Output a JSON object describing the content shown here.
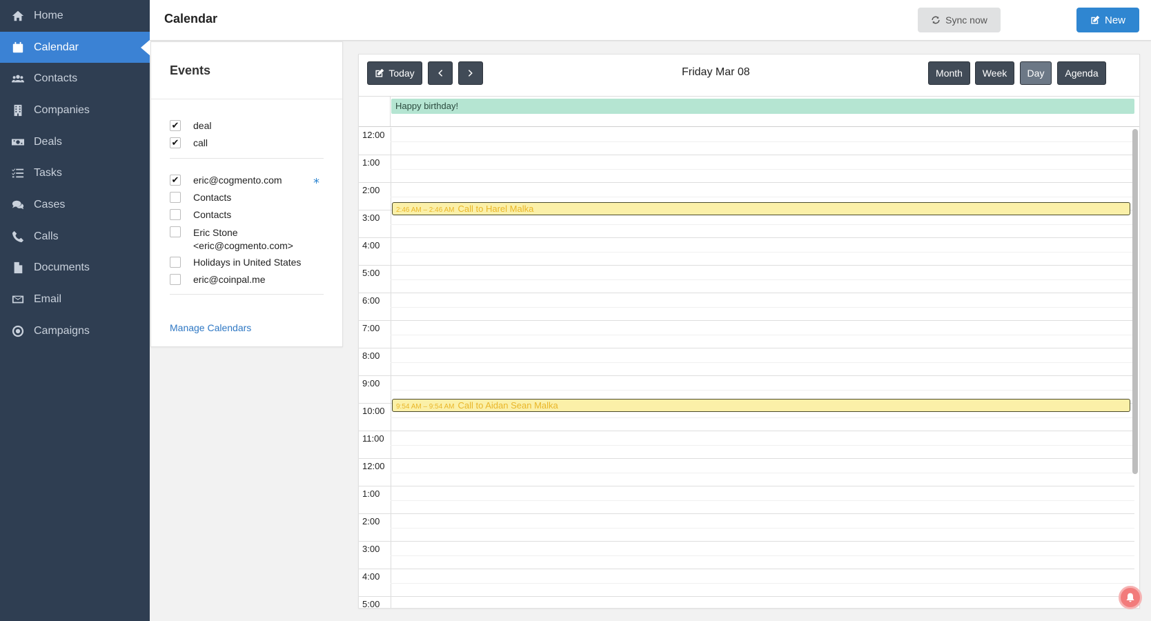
{
  "sidebar": {
    "items": [
      {
        "label": "Home",
        "icon": "home-icon"
      },
      {
        "label": "Calendar",
        "icon": "calendar-icon",
        "active": true
      },
      {
        "label": "Contacts",
        "icon": "users-icon"
      },
      {
        "label": "Companies",
        "icon": "building-icon"
      },
      {
        "label": "Deals",
        "icon": "money-icon"
      },
      {
        "label": "Tasks",
        "icon": "tasks-icon"
      },
      {
        "label": "Cases",
        "icon": "comments-icon"
      },
      {
        "label": "Calls",
        "icon": "phone-icon"
      },
      {
        "label": "Documents",
        "icon": "file-icon"
      },
      {
        "label": "Email",
        "icon": "envelope-icon"
      },
      {
        "label": "Campaigns",
        "icon": "target-icon"
      }
    ]
  },
  "header": {
    "title": "Calendar",
    "sync_label": "Sync now",
    "new_label": "New"
  },
  "events_panel": {
    "title": "Events",
    "types": [
      {
        "label": "deal",
        "checked": true
      },
      {
        "label": "call",
        "checked": true
      }
    ],
    "calendars": [
      {
        "label": "eric@cogmento.com",
        "checked": true
      },
      {
        "label": "Contacts",
        "checked": false
      },
      {
        "label": "Contacts",
        "checked": false
      },
      {
        "label": "Eric Stone",
        "label2": "<eric@cogmento.com>",
        "checked": false
      },
      {
        "label": "Holidays in United States",
        "checked": false
      },
      {
        "label": "eric@coinpal.me",
        "checked": false
      }
    ],
    "default_marker": "*",
    "manage_link": "Manage Calendars"
  },
  "calendar": {
    "today_label": "Today",
    "date_label": "Friday Mar 08",
    "views": [
      "Month",
      "Week",
      "Day",
      "Agenda"
    ],
    "active_view": "Day",
    "all_day_event": "Happy birthday!",
    "hours": [
      "12:00",
      "1:00",
      "2:00",
      "3:00",
      "4:00",
      "5:00",
      "6:00",
      "7:00",
      "8:00",
      "9:00",
      "10:00",
      "11:00",
      "12:00",
      "1:00",
      "2:00",
      "3:00",
      "4:00",
      "5:00"
    ],
    "events": [
      {
        "time": "2:46 AM – 2:46 AM",
        "title": "Call to Harel Malka",
        "hour": 2.77
      },
      {
        "time": "9:54 AM – 9:54 AM",
        "title": "Call to Aidan Sean Malka",
        "hour": 9.9
      }
    ]
  },
  "colors": {
    "sidebar_bg": "#2f3e52",
    "accent": "#3b82d4",
    "event_bg": "#fbf0a8",
    "event_text": "#e9b628",
    "allday_bg": "#b5e5d2"
  }
}
